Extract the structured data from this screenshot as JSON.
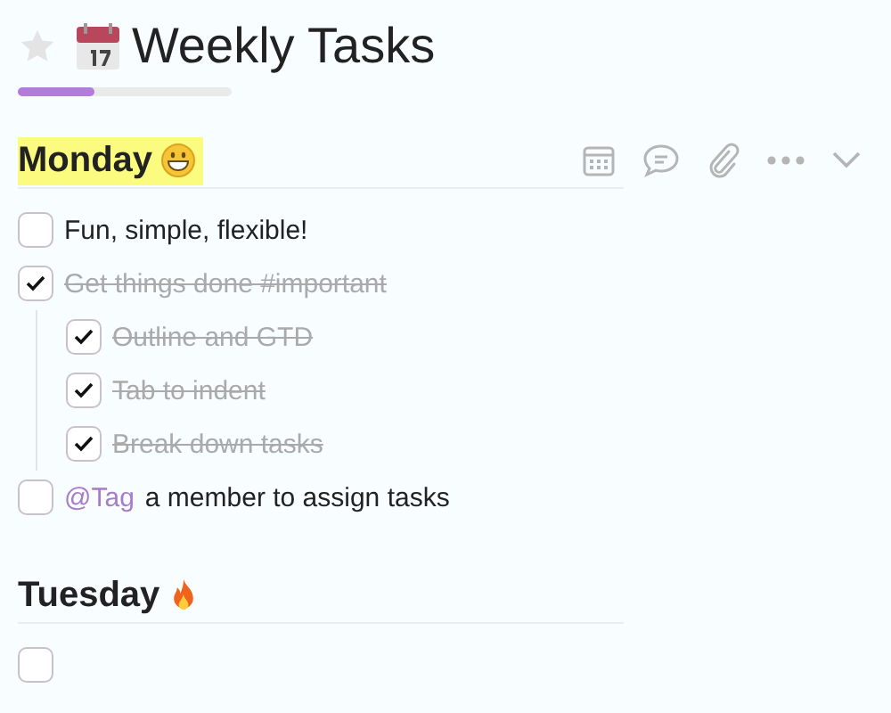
{
  "page": {
    "title": "Weekly Tasks",
    "starred": false,
    "progress": {
      "level": 0.36
    }
  },
  "sections": [
    {
      "title": "Monday",
      "kind": "grin",
      "highlighted": true,
      "tools": [
        {
          "kind": "calendar"
        },
        {
          "kind": "comment"
        },
        {
          "kind": "attach"
        },
        {
          "kind": "more"
        },
        {
          "kind": "collapse"
        }
      ],
      "tasks": [
        {
          "checked": false,
          "text": "Fun, simple, flexible!"
        },
        {
          "checked": true,
          "text": "Get things done #important",
          "children": [
            {
              "checked": true,
              "text": "Outline and GTD"
            },
            {
              "checked": true,
              "text": "Tab to indent"
            },
            {
              "checked": true,
              "text": "Break down tasks"
            }
          ]
        },
        {
          "checked": false,
          "mention": "@Tag",
          "text": "a member to assign tasks"
        }
      ]
    },
    {
      "title": "Tuesday",
      "kind": "fire",
      "highlighted": false,
      "tasks": [
        {
          "checked": false
        }
      ]
    }
  ]
}
